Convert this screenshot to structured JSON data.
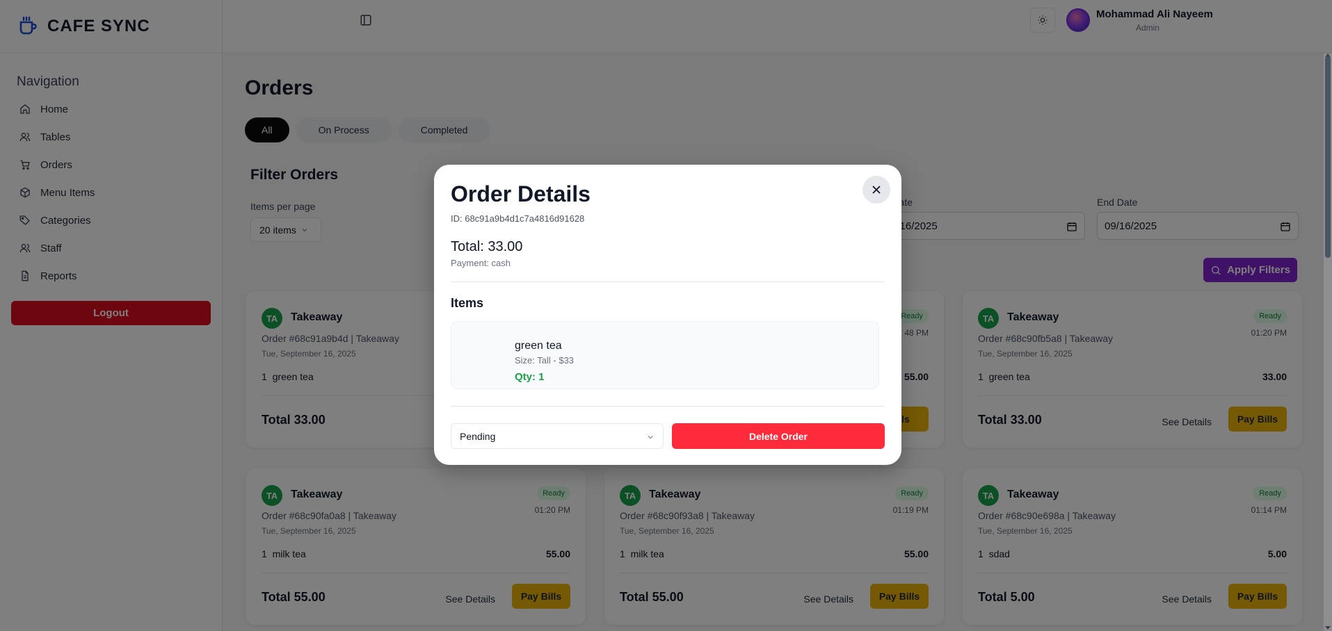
{
  "brand": {
    "name": "CAFE SYNC"
  },
  "sidebar": {
    "title": "Navigation",
    "items": [
      {
        "label": "Home",
        "icon": "home-icon"
      },
      {
        "label": "Tables",
        "icon": "users-icon"
      },
      {
        "label": "Orders",
        "icon": "cart-icon"
      },
      {
        "label": "Menu Items",
        "icon": "box-icon"
      },
      {
        "label": "Categories",
        "icon": "tag-icon"
      },
      {
        "label": "Staff",
        "icon": "users-icon"
      },
      {
        "label": "Reports",
        "icon": "file-icon"
      }
    ],
    "logout_label": "Logout"
  },
  "header": {
    "user_name": "Mohammad Ali Nayeem",
    "user_role": "Admin"
  },
  "page": {
    "title": "Orders",
    "tabs": [
      {
        "label": "All",
        "active": true
      },
      {
        "label": "On Process",
        "active": false
      },
      {
        "label": "Completed",
        "active": false
      }
    ]
  },
  "filters": {
    "title": "Filter Orders",
    "items_per_page_label": "Items per page",
    "items_per_page_value": "20 items",
    "start_date_label": "rt Date",
    "start_date_value": "9/16/2025",
    "end_date_label": "End Date",
    "end_date_value": "09/16/2025",
    "apply_label": "Apply Filters"
  },
  "cards": [
    {
      "initials": "TA",
      "type": "Takeaway",
      "order": "Order #68c91a9b4d | Takeaway",
      "date": "Tue, September 16, 2025",
      "status": "",
      "time": "",
      "item_qty": "1",
      "item_name": "green tea",
      "item_price": "",
      "total": "Total 33.00",
      "see_details": "See Details",
      "pay": "Pay Bills"
    },
    {
      "initials": "TA",
      "type": "Takeaway",
      "order": "",
      "date": "",
      "status": "Ready",
      "time": "48 PM",
      "item_qty": "",
      "item_name": "",
      "item_price": "55.00",
      "total": "",
      "see_details": "",
      "pay": "Bills"
    },
    {
      "initials": "TA",
      "type": "Takeaway",
      "order": "Order #68c90fb5a8 | Takeaway",
      "date": "Tue, September 16, 2025",
      "status": "Ready",
      "time": "01:20 PM",
      "item_qty": "1",
      "item_name": "green tea",
      "item_price": "33.00",
      "total": "Total 33.00",
      "see_details": "See Details",
      "pay": "Pay Bills"
    },
    {
      "initials": "TA",
      "type": "Takeaway",
      "order": "Order #68c90fa0a8 | Takeaway",
      "date": "Tue, September 16, 2025",
      "status": "Ready",
      "time": "01:20 PM",
      "item_qty": "1",
      "item_name": "milk tea",
      "item_price": "55.00",
      "total": "Total 55.00",
      "see_details": "See Details",
      "pay": "Pay Bills"
    },
    {
      "initials": "TA",
      "type": "Takeaway",
      "order": "Order #68c90f93a8 | Takeaway",
      "date": "Tue, September 16, 2025",
      "status": "Ready",
      "time": "01:19 PM",
      "item_qty": "1",
      "item_name": "milk tea",
      "item_price": "55.00",
      "total": "Total 55.00",
      "see_details": "See Details",
      "pay": "Pay Bills"
    },
    {
      "initials": "TA",
      "type": "Takeaway",
      "order": "Order #68c90e698a | Takeaway",
      "date": "Tue, September 16, 2025",
      "status": "Ready",
      "time": "01:14 PM",
      "item_qty": "1",
      "item_name": "sdad",
      "item_price": "5.00",
      "total": "Total 5.00",
      "see_details": "See Details",
      "pay": "Pay Bills"
    }
  ],
  "modal": {
    "title": "Order Details",
    "id": "ID: 68c91a9b4d1c7a4816d91628",
    "total": "Total: 33.00",
    "payment": "Payment: cash",
    "items_title": "Items",
    "item": {
      "name": "green tea",
      "size": "Size: Tall - $33",
      "qty": "Qty: 1"
    },
    "status_value": "Pending",
    "delete_label": "Delete Order"
  },
  "colors": {
    "logout": "#dc0d1e",
    "apply": "#7e22ce",
    "pay": "#eab308",
    "delete": "#ff2a3a",
    "ready_badge": "#dcfce7",
    "qty": "#16a34a"
  }
}
